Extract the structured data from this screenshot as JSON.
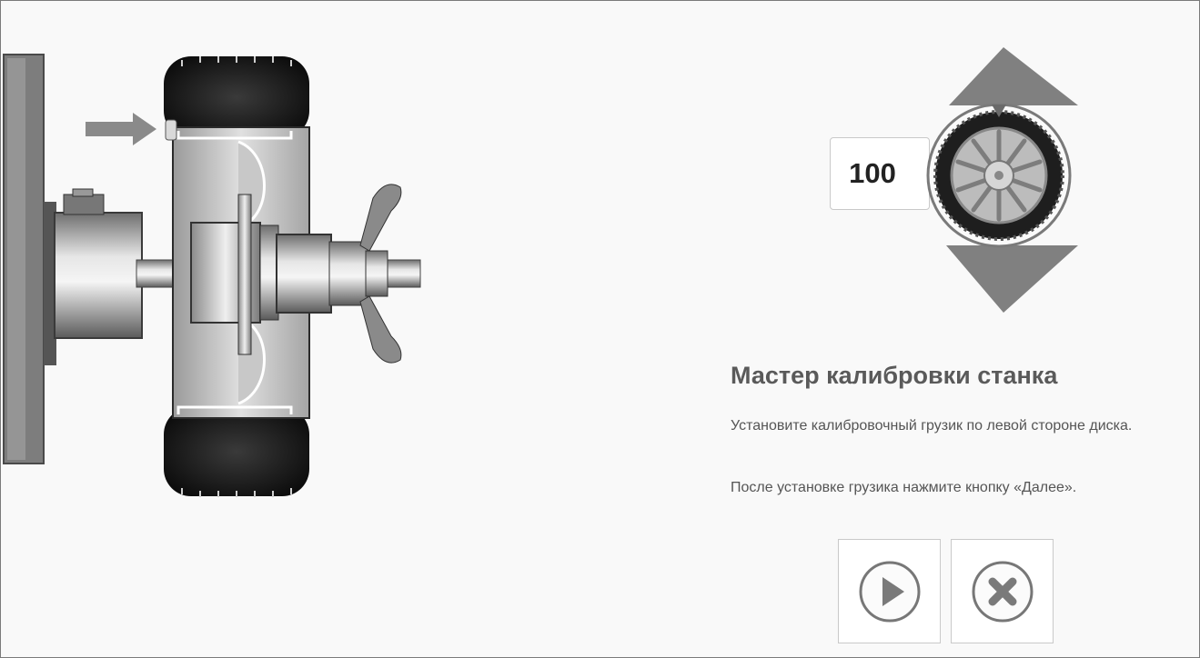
{
  "weight_counter": {
    "value": "100",
    "increase_icon": "triangle-up-icon",
    "decrease_icon": "triangle-down-icon",
    "wheel_icon": "wheel-icon"
  },
  "wizard": {
    "title": "Мастер калибровки станка",
    "instructions": [
      "Установите калибровочный грузик по левой стороне диска.",
      "После установке грузика нажмите кнопку «Далее»."
    ]
  },
  "actions": {
    "next_icon": "play-icon",
    "cancel_icon": "close-icon"
  },
  "colors": {
    "background": "#f9f9f9",
    "arrow": "#808080",
    "text": "#555555",
    "tire": "#1a1a1a"
  }
}
